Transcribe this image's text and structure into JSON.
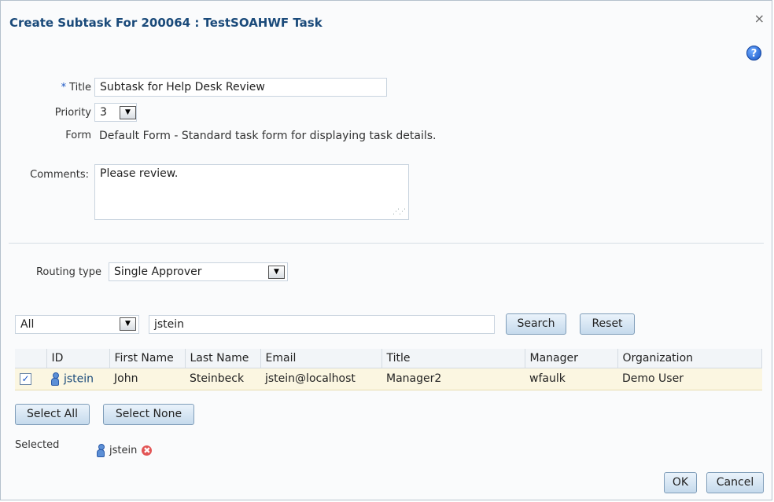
{
  "dialog": {
    "title": "Create Subtask For 200064 : TestSOAHWF Task",
    "close_glyph": "×",
    "help_glyph": "?"
  },
  "form": {
    "required_marker": "*",
    "title_label": "Title",
    "title_value": "Subtask for Help Desk Review",
    "priority_label": "Priority",
    "priority_value": "3",
    "form_label": "Form",
    "form_value": "Default Form - Standard task form for displaying task details.",
    "comments_label": "Comments:",
    "comments_value": "Please review."
  },
  "routing": {
    "label": "Routing type",
    "value": "Single Approver"
  },
  "search": {
    "filter_value": "All",
    "query_value": "jstein",
    "search_label": "Search",
    "reset_label": "Reset"
  },
  "table": {
    "headers": {
      "id": "ID",
      "first_name": "First Name",
      "last_name": "Last Name",
      "email": "Email",
      "title": "Title",
      "manager": "Manager",
      "organization": "Organization"
    },
    "rows": [
      {
        "checked": "✓",
        "id": "jstein",
        "first_name": "John",
        "last_name": "Steinbeck",
        "email": "jstein@localhost",
        "title": "Manager2",
        "manager": "wfaulk",
        "organization": "Demo User"
      }
    ]
  },
  "selection": {
    "select_all_label": "Select All",
    "select_none_label": "Select None",
    "selected_label": "Selected",
    "selected_user": "jstein",
    "remove_glyph": "✖"
  },
  "footer": {
    "ok_label": "OK",
    "cancel_label": "Cancel"
  },
  "icons": [
    "close-icon",
    "help-icon",
    "chevron-down-icon",
    "person-icon",
    "remove-icon",
    "resize-grip-icon"
  ],
  "colors": {
    "title_text": "#1a4a7a",
    "button_gradient_top": "#eaf3fb",
    "button_gradient_bottom": "#c5daec",
    "selected_row": "#fbf6e1",
    "help_icon": "#1a56c4",
    "remove_icon": "#e25555"
  }
}
